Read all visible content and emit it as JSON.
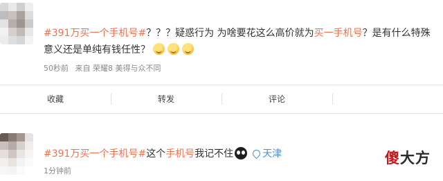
{
  "posts": [
    {
      "topic": "#391万买一个手机号#",
      "text_a": "？？？疑惑行为 为啥要花这么高价就为",
      "highlight": "买一手机号",
      "text_b": "？是有什么特殊意义还是单纯有钱任性？",
      "emoji_names": [
        "smile-icon",
        "smile-icon",
        "smile-icon"
      ],
      "time": "50秒前",
      "source": "来自 荣耀8 美得与众不同"
    },
    {
      "topic": "#391万买一个手机号#",
      "text_a": "这个",
      "highlight": "手机号",
      "text_b": "我记不住",
      "location": "天津",
      "time": "1分钟前"
    }
  ],
  "actions": {
    "favorite": "收藏",
    "repost": "转发",
    "comment": "评论"
  },
  "watermark": {
    "first": "傻",
    "rest": "大方"
  },
  "colors": {
    "topic": "#eb7350",
    "location": "#4a90d9",
    "watermark_red": "#c4161c"
  }
}
